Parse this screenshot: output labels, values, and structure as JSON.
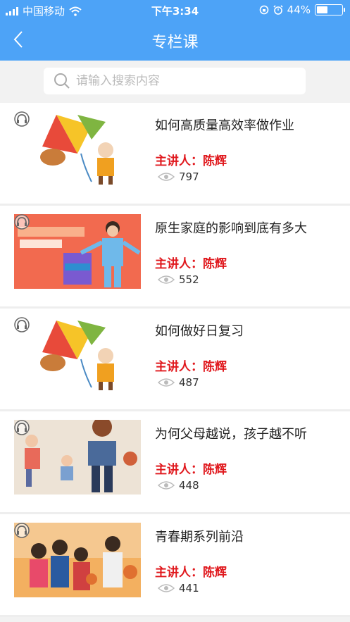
{
  "status": {
    "carrier": "中国移动",
    "time": "下午3:34",
    "battery": "44%"
  },
  "nav": {
    "title": "专栏课"
  },
  "search": {
    "placeholder": "请输入搜索内容"
  },
  "items": [
    {
      "title": "如何高质量高效率做作业",
      "speaker": "主讲人：陈辉",
      "views": "797",
      "thumb": "kite"
    },
    {
      "title": "原生家庭的影响到底有多大",
      "speaker": "主讲人：陈辉",
      "views": "552",
      "thumb": "teacher"
    },
    {
      "title": "如何做好日复习",
      "speaker": "主讲人：陈辉",
      "views": "487",
      "thumb": "kite"
    },
    {
      "title": "为何父母越说，孩子越不听",
      "speaker": "主讲人：陈辉",
      "views": "448",
      "thumb": "family"
    },
    {
      "title": "青春期系列前沿",
      "speaker": "主讲人：陈辉",
      "views": "441",
      "thumb": "teens"
    }
  ],
  "colors": {
    "header": "#4da3f7",
    "speaker": "#e0181d"
  }
}
